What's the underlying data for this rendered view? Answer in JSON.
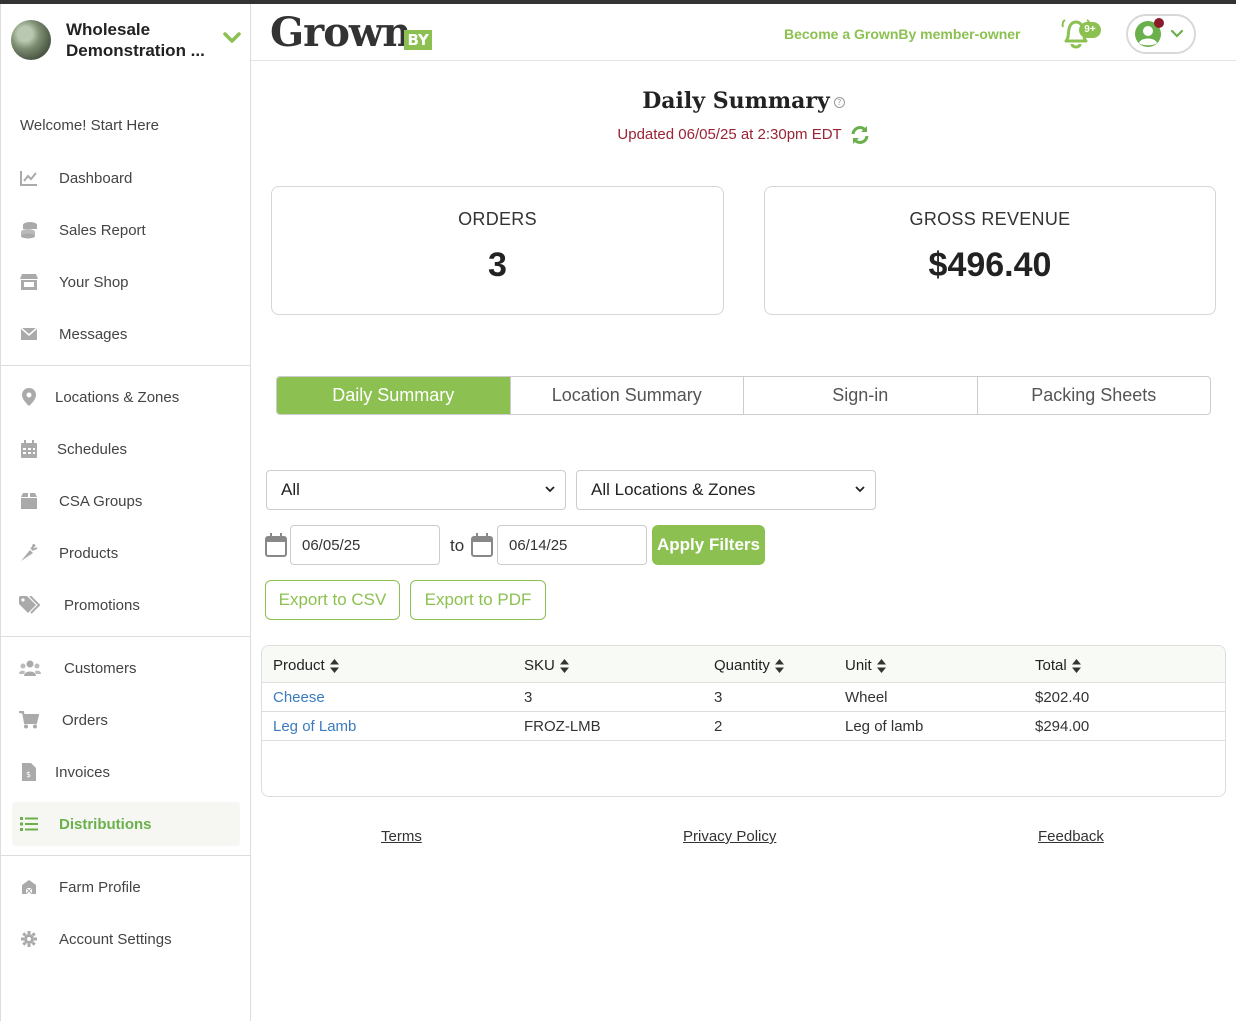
{
  "sidebar": {
    "farm_name": "Wholesale Demonstration ...",
    "welcome": "Welcome! Start Here",
    "group1": [
      {
        "label": "Dashboard",
        "icon": "chart-line-icon"
      },
      {
        "label": "Sales Report",
        "icon": "coins-icon"
      },
      {
        "label": "Your Shop",
        "icon": "store-icon"
      },
      {
        "label": "Messages",
        "icon": "envelope-icon"
      }
    ],
    "group2": [
      {
        "label": "Locations & Zones",
        "icon": "map-pin-icon"
      },
      {
        "label": "Schedules",
        "icon": "calendar-icon"
      },
      {
        "label": "CSA Groups",
        "icon": "box-icon"
      },
      {
        "label": "Products",
        "icon": "carrot-icon"
      },
      {
        "label": "Promotions",
        "icon": "tags-icon"
      }
    ],
    "group3": [
      {
        "label": "Customers",
        "icon": "users-icon"
      },
      {
        "label": "Orders",
        "icon": "cart-icon"
      },
      {
        "label": "Invoices",
        "icon": "invoice-icon"
      },
      {
        "label": "Distributions",
        "icon": "list-icon",
        "active": true
      }
    ],
    "group4": [
      {
        "label": "Farm Profile",
        "icon": "farm-icon"
      },
      {
        "label": "Account Settings",
        "icon": "gear-icon"
      }
    ]
  },
  "header": {
    "logo_main": "Grown",
    "logo_by": "BY",
    "member_link": "Become a GrownBy member-owner",
    "notification_badge": "9+"
  },
  "main": {
    "title": "Daily Summary",
    "updated": "Updated 06/05/25 at 2:30pm EDT",
    "stats": {
      "orders_label": "ORDERS",
      "orders_value": "3",
      "revenue_label": "GROSS REVENUE",
      "revenue_value": "$496.40"
    },
    "tabs": [
      "Daily Summary",
      "Location Summary",
      "Sign-in",
      "Packing Sheets"
    ],
    "filters": {
      "type_selected": "All",
      "location_selected": "All Locations & Zones",
      "date_from": "06/05/25",
      "to_label": "to",
      "date_to": "06/14/25",
      "apply": "Apply Filters"
    },
    "export_csv": "Export to CSV",
    "export_pdf": "Export to PDF",
    "table": {
      "headers": [
        "Product",
        "SKU",
        "Quantity",
        "Unit",
        "Total"
      ],
      "rows": [
        [
          "Cheese",
          "3",
          "3",
          "Wheel",
          "$202.40"
        ],
        [
          "Leg of Lamb",
          "FROZ-LMB",
          "2",
          "Leg of lamb",
          "$294.00"
        ]
      ]
    },
    "footer": {
      "terms": "Terms",
      "privacy": "Privacy Policy",
      "feedback": "Feedback"
    }
  },
  "colors": {
    "accent": "#8cc152",
    "updated_text": "#9b2335",
    "link": "#3a7bbf"
  }
}
